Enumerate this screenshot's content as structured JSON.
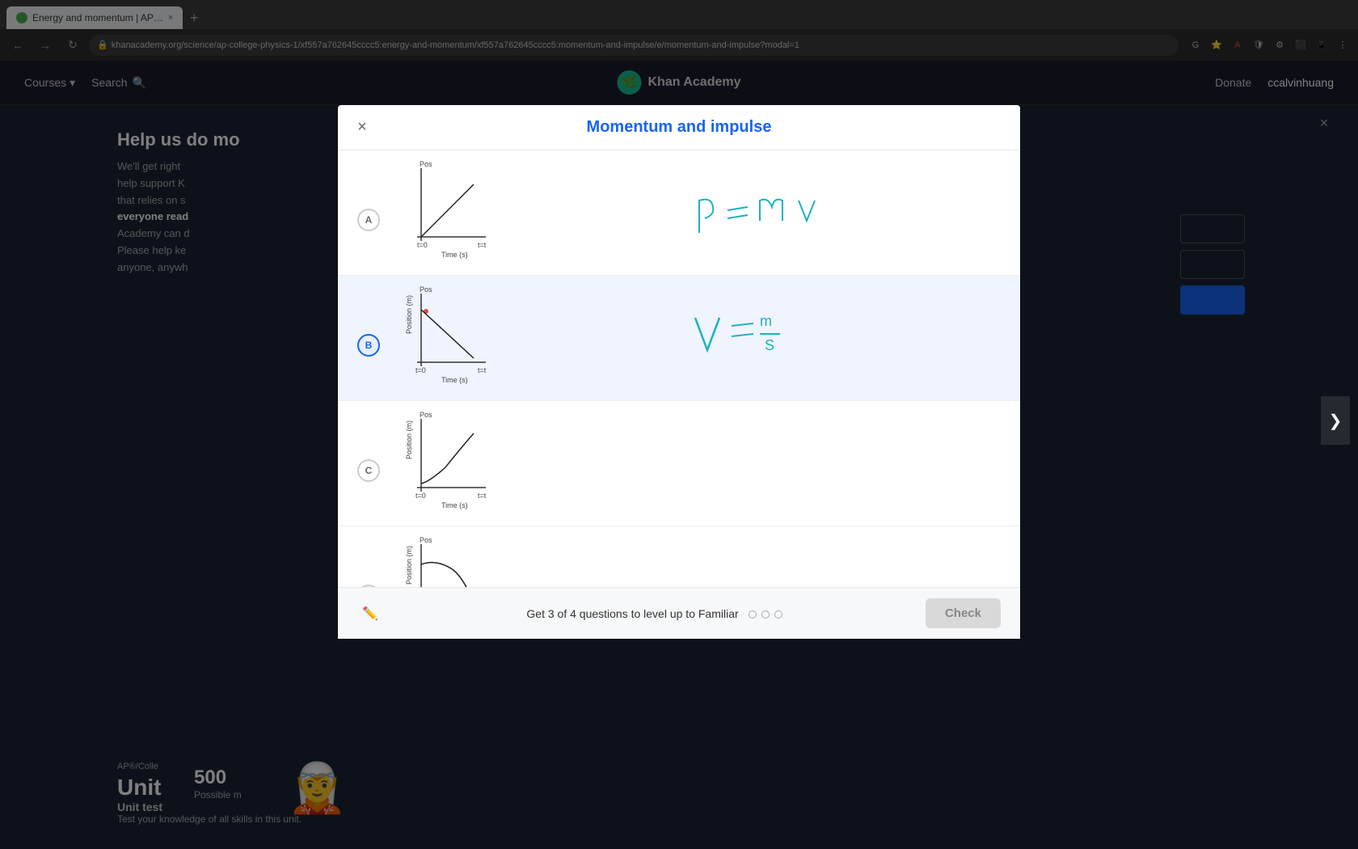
{
  "browser": {
    "tab_title": "Energy and momentum | AP…",
    "tab_favicon_color": "#4caf50",
    "url": "khanacademy.org/science/ap-college-physics-1/xf557a762645cccc5:energy-and-momentum/xf557a762645cccc5:momentum-and-impulse/e/momentum-and-impulse?modal=1",
    "nav": {
      "back": "←",
      "forward": "→",
      "refresh": "↻"
    }
  },
  "ka_header": {
    "courses": "Courses",
    "courses_arrow": "▾",
    "search": "Search",
    "logo_text": "Khan Academy",
    "donate": "Donate",
    "username": "ccalvinhuang"
  },
  "modal": {
    "title": "Momentum and impulse",
    "close_icon": "×",
    "footer": {
      "tool_icon": "✏",
      "progress_text": "Get 3 of 4 questions to level up to Familiar",
      "dots": [
        {
          "filled": false
        },
        {
          "filled": false
        },
        {
          "filled": false
        }
      ],
      "check_label": "Check"
    },
    "options": [
      {
        "id": "A",
        "selected": false,
        "graph_type": "linear_up",
        "formula": "p = m v"
      },
      {
        "id": "B",
        "selected": true,
        "graph_type": "linear_down",
        "formula": "v = m/s"
      },
      {
        "id": "C",
        "selected": false,
        "graph_type": "curve_up",
        "formula": ""
      },
      {
        "id": "D",
        "selected": false,
        "graph_type": "curve_down",
        "formula": ""
      }
    ]
  },
  "background": {
    "help_heading": "Help us do mo",
    "help_text_1": "We'll get right",
    "help_text_2": "help support K",
    "help_text_3": "that relies on s",
    "help_text_bold": "everyone read",
    "help_text_4": "Academy can d",
    "help_text_5": "Please help ke",
    "help_text_6": "anyone, anywh",
    "ap_label": "AP®/Colle",
    "unit_title": "Unit",
    "possible": "500",
    "possible_label": "Possible m",
    "unit_test_label": "Unit test",
    "unit_test_desc": "Test your knowledge of all\nskills in this unit."
  },
  "page_close": "×",
  "next_arrow": "❯"
}
